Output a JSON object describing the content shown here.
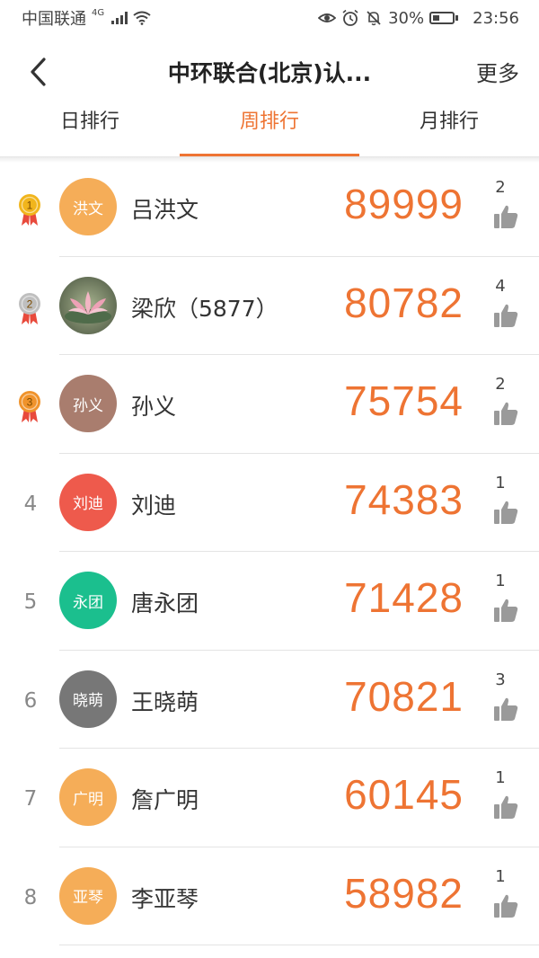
{
  "status_bar": {
    "carrier": "中国联通",
    "network": "4G",
    "battery": "30%",
    "time": "23:56"
  },
  "nav": {
    "title": "中环联合(北京)认...",
    "more": "更多"
  },
  "tabs": [
    {
      "label": "日排行",
      "active": false
    },
    {
      "label": "周排行",
      "active": true
    },
    {
      "label": "月排行",
      "active": false
    }
  ],
  "colors": {
    "accent": "#ee7433",
    "gold": "#f1b51c",
    "silver": "#bfbfbf",
    "bronze": "#f0932b"
  },
  "ranking": [
    {
      "rank": "1",
      "medal": "gold",
      "avatar_text": "洪文",
      "avatar_color": "#f5ad58",
      "name": "吕洪文",
      "score": "89999",
      "likes": "2"
    },
    {
      "rank": "2",
      "medal": "silver",
      "avatar_text": "",
      "avatar_color": "photo",
      "name": "梁欣（5877）",
      "score": "80782",
      "likes": "4"
    },
    {
      "rank": "3",
      "medal": "bronze",
      "avatar_text": "孙义",
      "avatar_color": "#a97d6e",
      "name": "孙义",
      "score": "75754",
      "likes": "2"
    },
    {
      "rank": "4",
      "medal": "",
      "avatar_text": "刘迪",
      "avatar_color": "#ee5a4c",
      "name": "刘迪",
      "score": "74383",
      "likes": "1"
    },
    {
      "rank": "5",
      "medal": "",
      "avatar_text": "永团",
      "avatar_color": "#1bbf8e",
      "name": "唐永团",
      "score": "71428",
      "likes": "1"
    },
    {
      "rank": "6",
      "medal": "",
      "avatar_text": "晓萌",
      "avatar_color": "#777777",
      "name": "王晓萌",
      "score": "70821",
      "likes": "3"
    },
    {
      "rank": "7",
      "medal": "",
      "avatar_text": "广明",
      "avatar_color": "#f5ad58",
      "name": "詹广明",
      "score": "60145",
      "likes": "1"
    },
    {
      "rank": "8",
      "medal": "",
      "avatar_text": "亚琴",
      "avatar_color": "#f5ad58",
      "name": "李亚琴",
      "score": "58982",
      "likes": "1"
    }
  ]
}
